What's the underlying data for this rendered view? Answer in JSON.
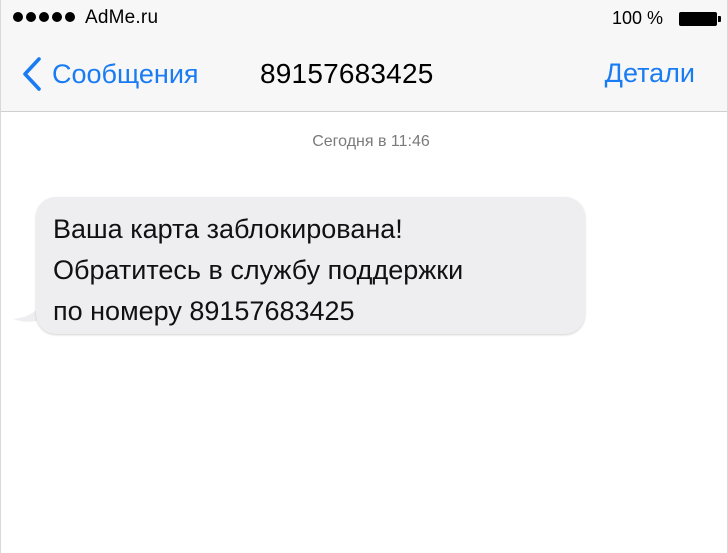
{
  "status_bar": {
    "signal_icon": "signal-dots-icon",
    "carrier": "AdMe.ru",
    "battery_percent": "100 %",
    "battery_icon": "battery-icon"
  },
  "nav": {
    "back_icon": "chevron-left-icon",
    "back_label": "Сообщения",
    "title": "89157683425",
    "details_label": "Детали",
    "accent_color": "#1a7cf2"
  },
  "conversation": {
    "timestamp": "Сегодня в 11:46",
    "messages": [
      {
        "direction": "incoming",
        "bubble_color": "#eeeef0",
        "lines": [
          "Ваша карта заблокирована!",
          "Обратитесь в службу поддержки",
          "по номеру 89157683425"
        ]
      }
    ]
  }
}
